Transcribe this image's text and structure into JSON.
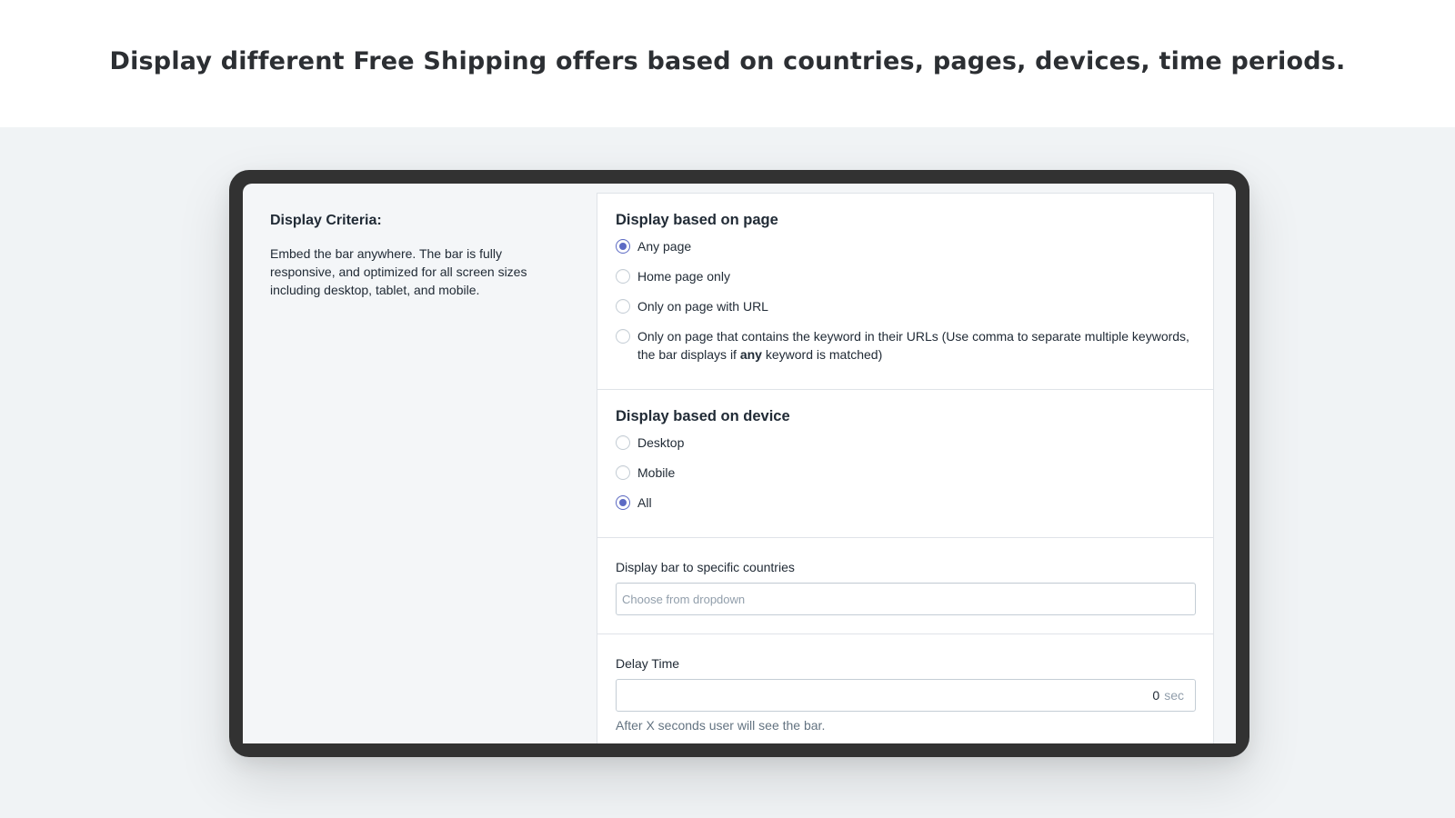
{
  "headline": "Display different Free Shipping offers based on countries, pages, devices, time periods.",
  "left": {
    "title": "Display Criteria:",
    "description": "Embed the bar anywhere. The bar is fully responsive, and optimized for all screen sizes including desktop, tablet, and mobile."
  },
  "page_section": {
    "title": "Display based on page",
    "options": [
      {
        "label": "Any page",
        "checked": true
      },
      {
        "label": "Home page only",
        "checked": false
      },
      {
        "label": "Only on page with URL",
        "checked": false
      },
      {
        "label_before": "Only on page that contains the keyword in their URLs (Use comma to separate multiple keywords, the bar displays if ",
        "label_bold": "any",
        "label_after": " keyword is matched)",
        "checked": false
      }
    ]
  },
  "device_section": {
    "title": "Display based on device",
    "options": [
      {
        "label": "Desktop",
        "checked": false
      },
      {
        "label": "Mobile",
        "checked": false
      },
      {
        "label": "All",
        "checked": true
      }
    ]
  },
  "countries": {
    "label": "Display bar to specific countries",
    "placeholder": "Choose from dropdown"
  },
  "delay": {
    "label": "Delay Time",
    "value": "0",
    "suffix": "sec",
    "help": "After X seconds user will see the bar."
  },
  "colors": {
    "accent": "#5c6ac4",
    "device_frame": "#323232",
    "background": "#f0f3f5"
  }
}
